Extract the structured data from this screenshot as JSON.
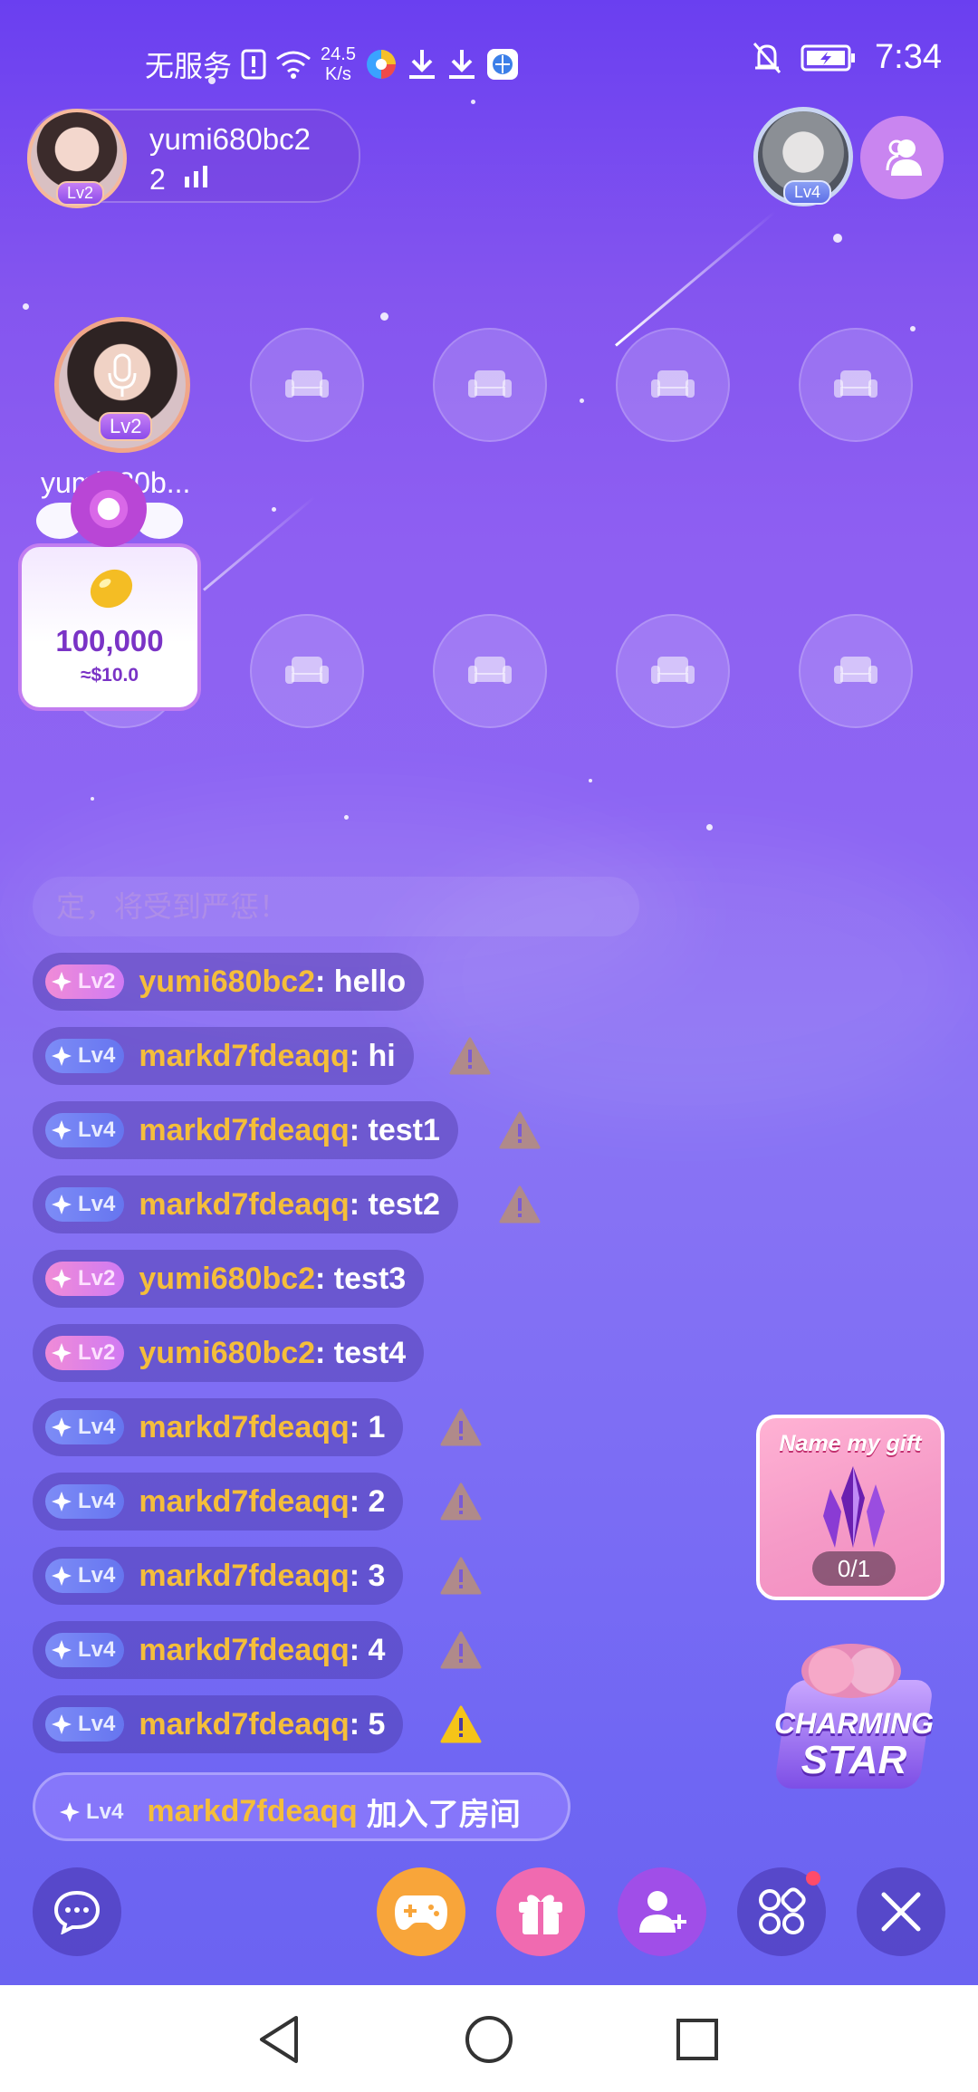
{
  "status_bar": {
    "carrier": "无服务",
    "speed_value": "24.5",
    "speed_unit": "K/s",
    "time": "7:34"
  },
  "host": {
    "name": "yumi680bc2",
    "viewer_count": "2",
    "level": "Lv2"
  },
  "top_right": {
    "gift_level": "Lv4"
  },
  "mic_seat": {
    "level": "Lv2",
    "name": "yumi680b..."
  },
  "balloon": {
    "amount": "100,000",
    "usd": "≈$10.0"
  },
  "chat": {
    "faded_text": "定，将受到严惩！",
    "messages": [
      {
        "level": "Lv2",
        "user": "yumi680bc2",
        "text": " : hello",
        "warn": false
      },
      {
        "level": "Lv4",
        "user": "markd7fdeaqq",
        "text": " : hi",
        "warn": true
      },
      {
        "level": "Lv4",
        "user": "markd7fdeaqq",
        "text": " : test1",
        "warn": true
      },
      {
        "level": "Lv4",
        "user": "markd7fdeaqq",
        "text": " : test2",
        "warn": true
      },
      {
        "level": "Lv2",
        "user": "yumi680bc2",
        "text": " : test3",
        "warn": false
      },
      {
        "level": "Lv2",
        "user": "yumi680bc2",
        "text": " : test4",
        "warn": false
      },
      {
        "level": "Lv4",
        "user": "markd7fdeaqq",
        "text": " : 1",
        "warn": true
      },
      {
        "level": "Lv4",
        "user": "markd7fdeaqq",
        "text": " : 2",
        "warn": true
      },
      {
        "level": "Lv4",
        "user": "markd7fdeaqq",
        "text": " : 3",
        "warn": true
      },
      {
        "level": "Lv4",
        "user": "markd7fdeaqq",
        "text": " : 4",
        "warn": true
      },
      {
        "level": "Lv4",
        "user": "markd7fdeaqq",
        "text": " : 5",
        "warn": true
      }
    ],
    "join": {
      "level": "Lv4",
      "user": "markd7fdeaqq",
      "text": "加入了房间"
    }
  },
  "name_my_gift": {
    "title": "Name my gift",
    "progress": "0/1"
  },
  "charming_star": {
    "line1": "CHARMING",
    "line2": "STAR"
  },
  "colors": {
    "accent_gold": "#f5be3a",
    "game_button": "#f8a53a",
    "gift_button": "#f06ab0",
    "add_button": "#a04ee8",
    "warning_yellow": "#f5c418"
  }
}
